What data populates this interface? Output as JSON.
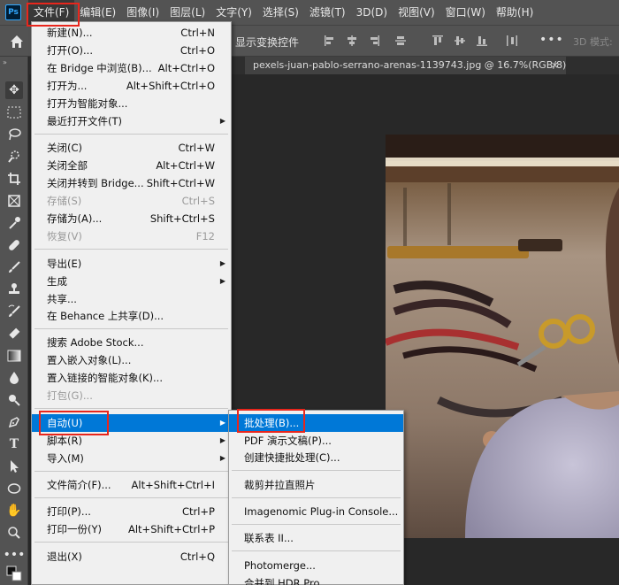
{
  "app": {
    "logo": "Ps"
  },
  "menubar": {
    "items": [
      "文件(F)",
      "编辑(E)",
      "图像(I)",
      "图层(L)",
      "文字(Y)",
      "选择(S)",
      "滤镜(T)",
      "3D(D)",
      "视图(V)",
      "窗口(W)",
      "帮助(H)"
    ]
  },
  "optionsbar": {
    "transform_label": "显示变换控件",
    "more": "•••",
    "mode3d_label": "3D 模式:"
  },
  "document": {
    "tab_title": "pexels-juan-pablo-serrano-arenas-1139743.jpg @ 16.7%(RGB/8)",
    "close": "×"
  },
  "file_menu": {
    "items": [
      {
        "label": "新建(N)...",
        "shortcut": "Ctrl+N"
      },
      {
        "label": "打开(O)...",
        "shortcut": "Ctrl+O"
      },
      {
        "label": "在 Bridge 中浏览(B)...",
        "shortcut": "Alt+Ctrl+O"
      },
      {
        "label": "打开为...",
        "shortcut": "Alt+Shift+Ctrl+O"
      },
      {
        "label": "打开为智能对象...",
        "shortcut": ""
      },
      {
        "label": "最近打开文件(T)",
        "shortcut": "",
        "submenu": true
      },
      {
        "label": "关闭(C)",
        "shortcut": "Ctrl+W"
      },
      {
        "label": "关闭全部",
        "shortcut": "Alt+Ctrl+W"
      },
      {
        "label": "关闭并转到 Bridge...",
        "shortcut": "Shift+Ctrl+W"
      },
      {
        "label": "存储(S)",
        "shortcut": "Ctrl+S",
        "disabled": true
      },
      {
        "label": "存储为(A)...",
        "shortcut": "Shift+Ctrl+S"
      },
      {
        "label": "恢复(V)",
        "shortcut": "F12",
        "disabled": true
      },
      {
        "label": "导出(E)",
        "shortcut": "",
        "submenu": true
      },
      {
        "label": "生成",
        "shortcut": "",
        "submenu": true
      },
      {
        "label": "共享...",
        "shortcut": ""
      },
      {
        "label": "在 Behance 上共享(D)...",
        "shortcut": ""
      },
      {
        "label": "搜索 Adobe Stock...",
        "shortcut": ""
      },
      {
        "label": "置入嵌入对象(L)...",
        "shortcut": ""
      },
      {
        "label": "置入链接的智能对象(K)...",
        "shortcut": ""
      },
      {
        "label": "打包(G)...",
        "shortcut": "",
        "disabled": true
      },
      {
        "label": "自动(U)",
        "shortcut": "",
        "submenu": true,
        "highlighted": true
      },
      {
        "label": "脚本(R)",
        "shortcut": "",
        "submenu": true
      },
      {
        "label": "导入(M)",
        "shortcut": "",
        "submenu": true
      },
      {
        "label": "文件简介(F)...",
        "shortcut": "Alt+Shift+Ctrl+I"
      },
      {
        "label": "打印(P)...",
        "shortcut": "Ctrl+P"
      },
      {
        "label": "打印一份(Y)",
        "shortcut": "Alt+Shift+Ctrl+P"
      },
      {
        "label": "退出(X)",
        "shortcut": "Ctrl+Q"
      }
    ]
  },
  "auto_submenu": {
    "items": [
      {
        "label": "批处理(B)...",
        "highlighted": true
      },
      {
        "label": "PDF 演示文稿(P)..."
      },
      {
        "label": "创建快捷批处理(C)..."
      },
      {
        "label": "裁剪并拉直照片"
      },
      {
        "label": "Imagenomic Plug-in Console..."
      },
      {
        "label": "联系表 II..."
      },
      {
        "label": "Photomerge..."
      },
      {
        "label": "合并到 HDR Pro..."
      }
    ]
  },
  "colors": {
    "ui_bg": "#535353",
    "canvas_bg": "#282828",
    "menu_bg": "#f0f0f0",
    "highlight": "#0078d7",
    "annotation": "#e8261c"
  }
}
